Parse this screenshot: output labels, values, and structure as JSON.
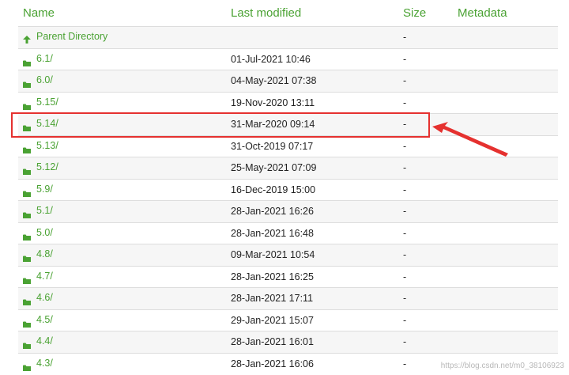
{
  "header": {
    "name": "Name",
    "last_modified": "Last modified",
    "size": "Size",
    "metadata": "Metadata"
  },
  "rows": [
    {
      "type": "parent",
      "icon": "arrow-up-icon",
      "name": "Parent Directory",
      "date": "",
      "size": "-"
    },
    {
      "type": "folder",
      "icon": "folder-icon",
      "name": "6.1/",
      "date": "01-Jul-2021 10:46",
      "size": "-"
    },
    {
      "type": "folder",
      "icon": "folder-icon",
      "name": "6.0/",
      "date": "04-May-2021 07:38",
      "size": "-"
    },
    {
      "type": "folder",
      "icon": "folder-icon",
      "name": "5.15/",
      "date": "19-Nov-2020 13:11",
      "size": "-"
    },
    {
      "type": "folder",
      "icon": "folder-icon",
      "name": "5.14/",
      "date": "31-Mar-2020 09:14",
      "size": "-"
    },
    {
      "type": "folder",
      "icon": "folder-icon",
      "name": "5.13/",
      "date": "31-Oct-2019 07:17",
      "size": "-"
    },
    {
      "type": "folder",
      "icon": "folder-icon",
      "name": "5.12/",
      "date": "25-May-2021 07:09",
      "size": "-"
    },
    {
      "type": "folder",
      "icon": "folder-icon",
      "name": "5.9/",
      "date": "16-Dec-2019 15:00",
      "size": "-"
    },
    {
      "type": "folder",
      "icon": "folder-icon",
      "name": "5.1/",
      "date": "28-Jan-2021 16:26",
      "size": "-"
    },
    {
      "type": "folder",
      "icon": "folder-icon",
      "name": "5.0/",
      "date": "28-Jan-2021 16:48",
      "size": "-"
    },
    {
      "type": "folder",
      "icon": "folder-icon",
      "name": "4.8/",
      "date": "09-Mar-2021 10:54",
      "size": "-"
    },
    {
      "type": "folder",
      "icon": "folder-icon",
      "name": "4.7/",
      "date": "28-Jan-2021 16:25",
      "size": "-"
    },
    {
      "type": "folder",
      "icon": "folder-icon",
      "name": "4.6/",
      "date": "28-Jan-2021 17:11",
      "size": "-"
    },
    {
      "type": "folder",
      "icon": "folder-icon",
      "name": "4.5/",
      "date": "29-Jan-2021 15:07",
      "size": "-"
    },
    {
      "type": "folder",
      "icon": "folder-icon",
      "name": "4.4/",
      "date": "28-Jan-2021 16:01",
      "size": "-"
    },
    {
      "type": "folder",
      "icon": "folder-icon",
      "name": "4.3/",
      "date": "28-Jan-2021 16:06",
      "size": "-"
    }
  ],
  "annotation": {
    "highlighted_row": "5.14/",
    "color": "#e5312f"
  },
  "watermark": "https://blog.csdn.net/m0_38106923",
  "colors": {
    "link": "#4aa233",
    "text": "#222222",
    "stripe": "#f6f6f6"
  }
}
